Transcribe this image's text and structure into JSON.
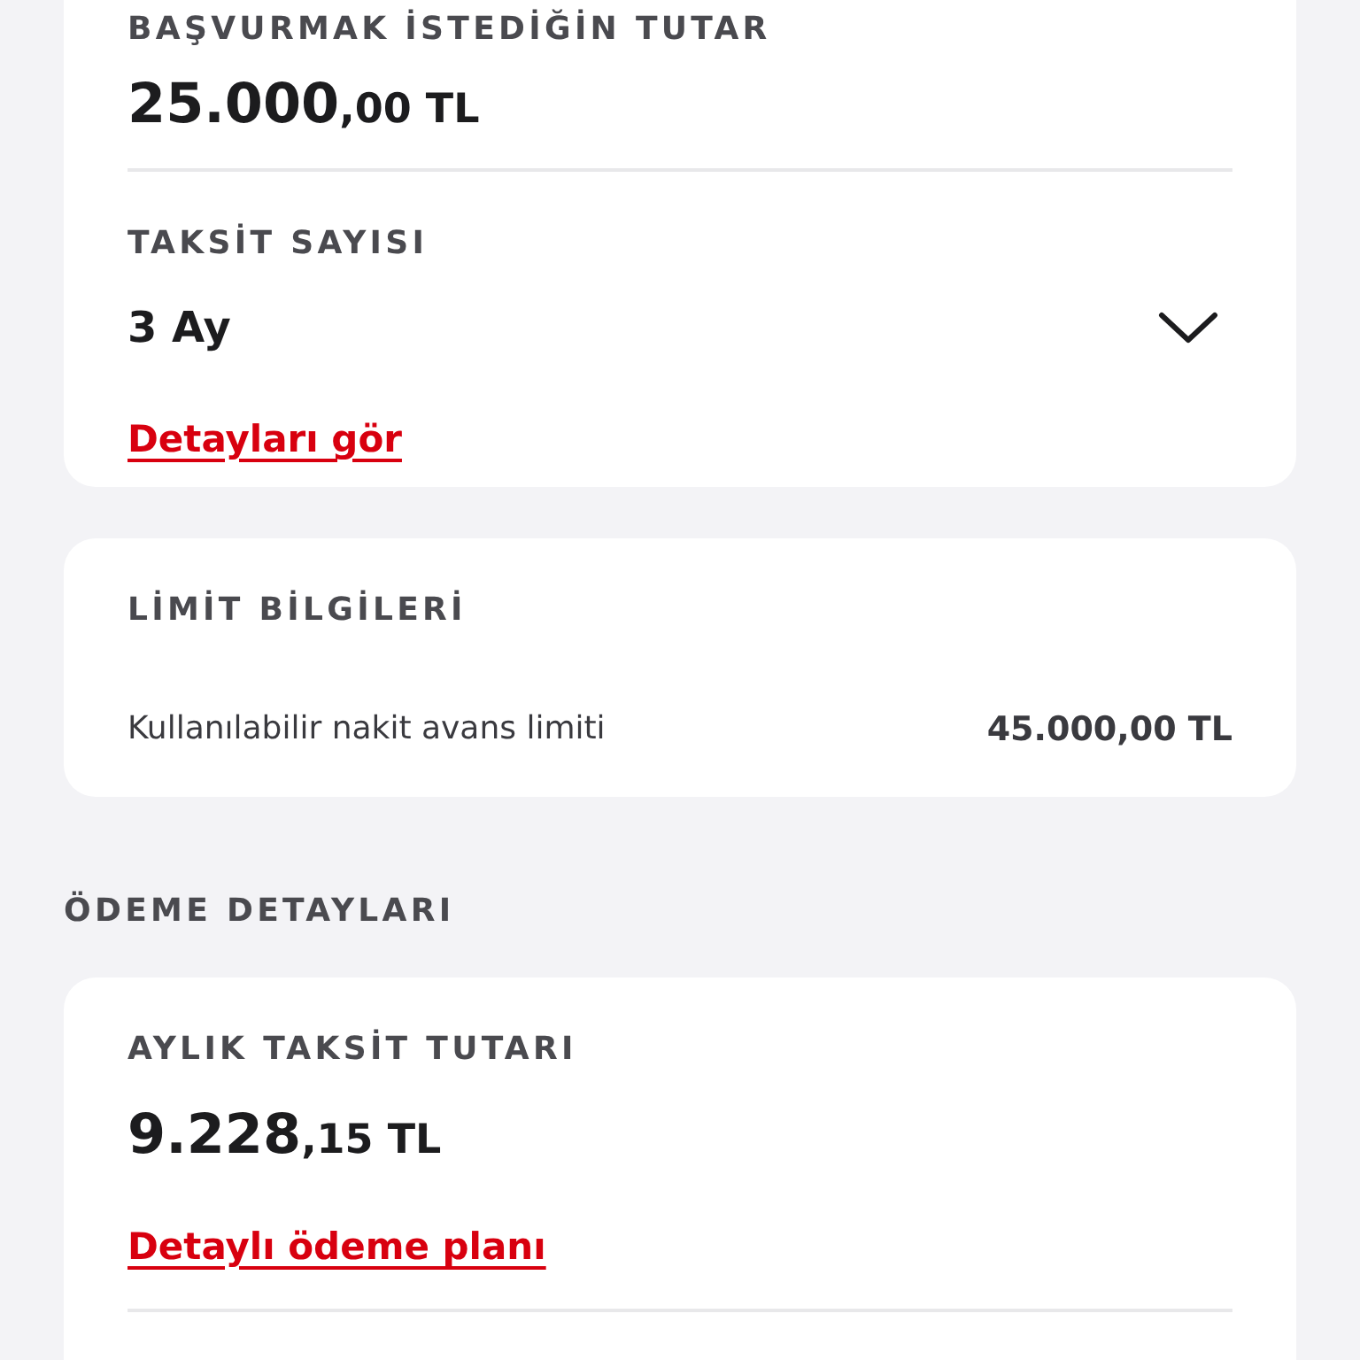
{
  "application_card": {
    "amount_label": "BAŞVURMAK İSTEDİĞİN TUTAR",
    "amount": {
      "whole": "25.000",
      "fraction": ",00 TL"
    },
    "installment_label": "TAKSİT SAYISI",
    "installment_value": "3 Ay",
    "details_link": "Detayları gör"
  },
  "limit_card": {
    "title": "LİMİT BİLGİLERİ",
    "rows": [
      {
        "label": "Kullanılabilir nakit avans limiti",
        "value": "45.000,00 TL"
      }
    ]
  },
  "payment_section": {
    "heading": "ÖDEME DETAYLARI",
    "monthly_label": "AYLIK TAKSİT TUTARI",
    "monthly_amount": {
      "whole": "9.228",
      "fraction": ",15 TL"
    },
    "plan_link": "Detaylı ödeme planı"
  }
}
